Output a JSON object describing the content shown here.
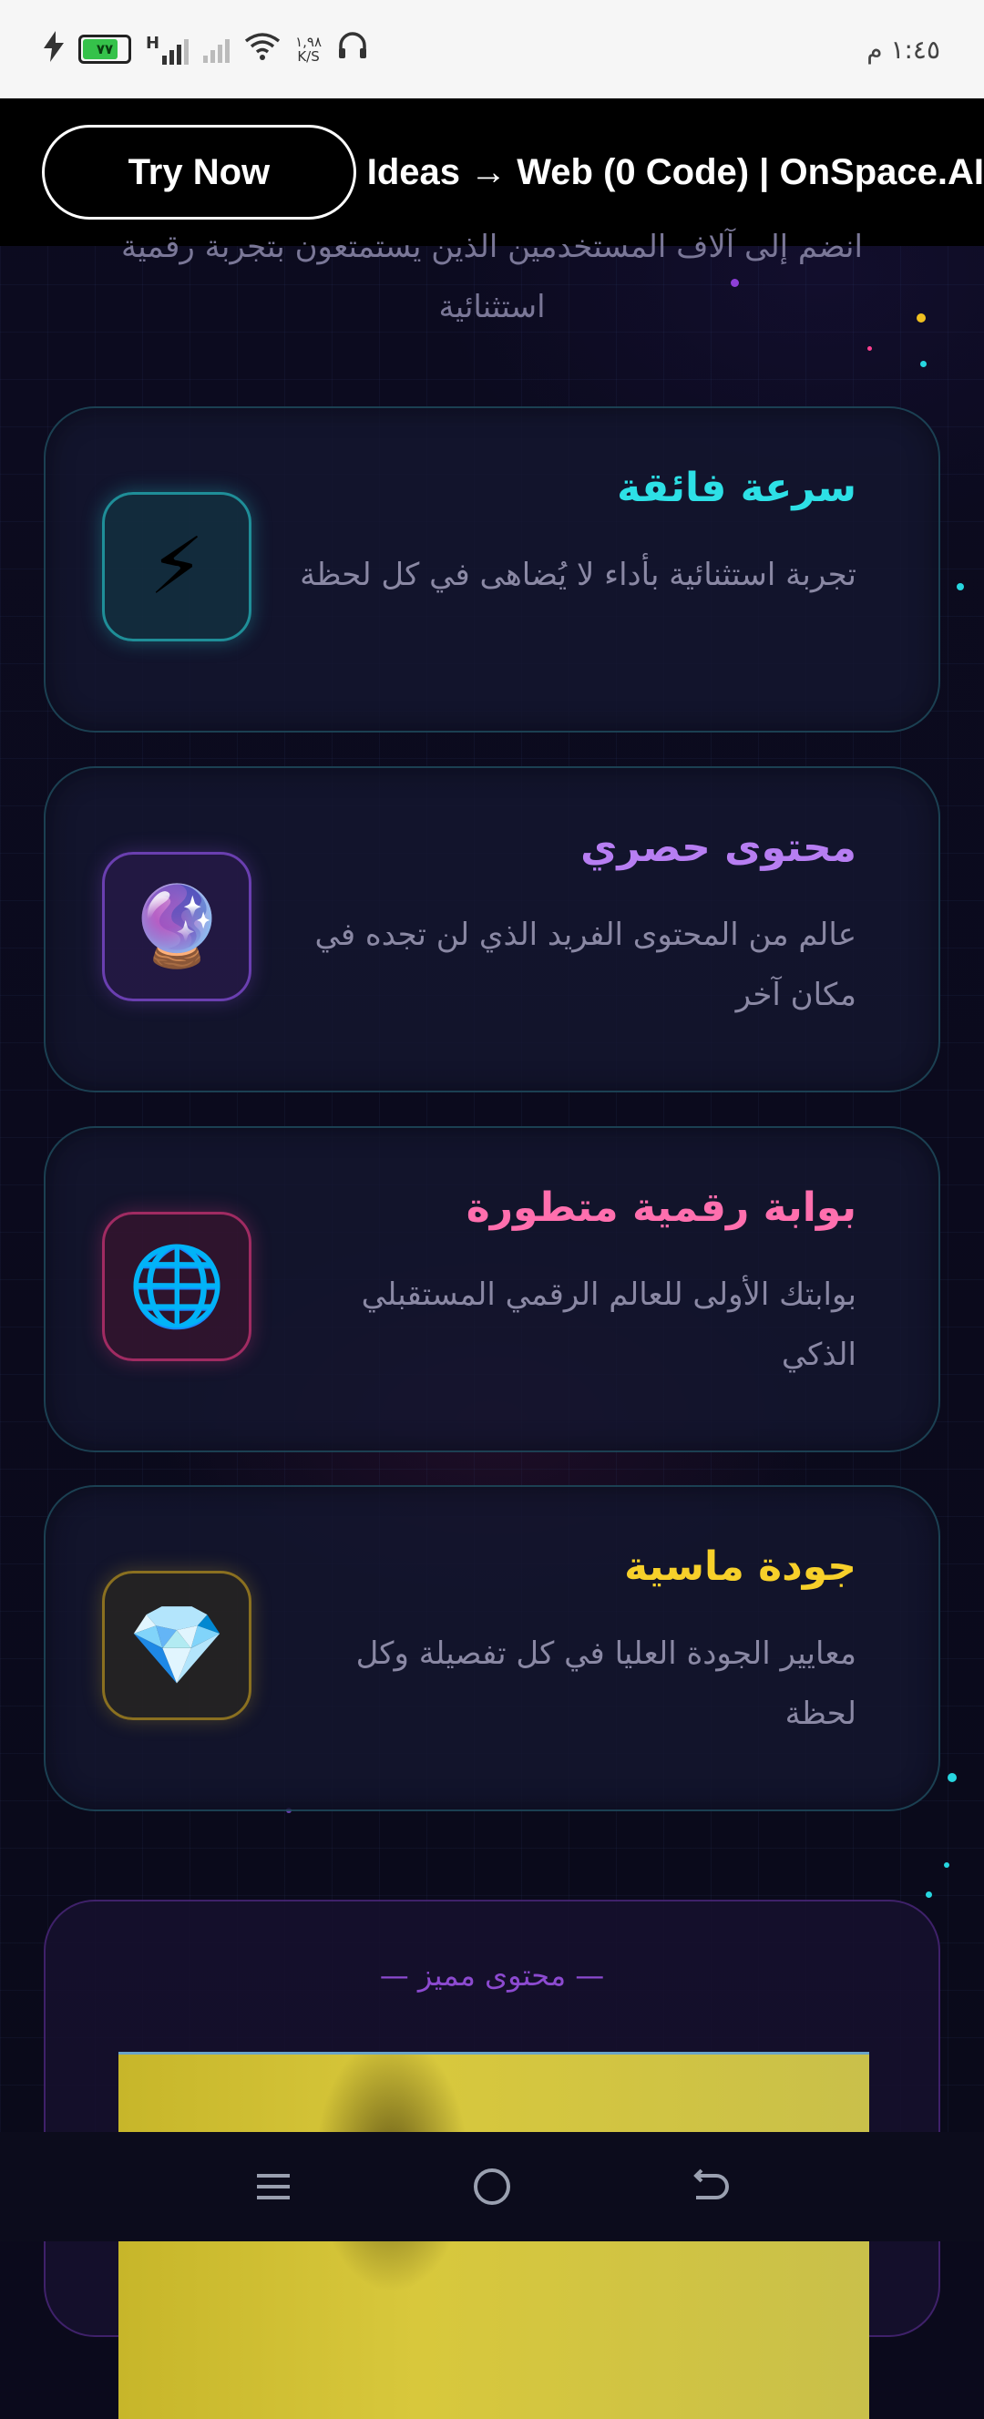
{
  "status_bar": {
    "time": "١:٤٥ م",
    "battery": "٧٧",
    "network_type": "H",
    "speed_value": "١,٩٨",
    "speed_unit": "K/S"
  },
  "banner": {
    "cta_label": "Try Now",
    "title": "Ideas → Web (0 Code) | OnSpace.AI"
  },
  "intro": {
    "text": "انضم إلى آلاف المستخدمين الذين يستمتعون بتجربة رقمية استثنائية"
  },
  "features": [
    {
      "title": "سرعة فائقة",
      "description": "تجربة استثنائية بأداء لا يُضاهى في كل لحظة",
      "icon": "lightning-icon",
      "glyph": "⚡",
      "title_color": "#2de0e6",
      "border_color": "#1f8e98"
    },
    {
      "title": "محتوى حصري",
      "description": "عالم من المحتوى الفريد الذي لن تجده في مكان آخر",
      "icon": "crystal-ball-icon",
      "glyph": "🔮",
      "title_color": "#b77ef2",
      "border_color": "#6a3fb0"
    },
    {
      "title": "بوابة رقمية متطورة",
      "description": "بوابتك الأولى للعالم الرقمي المستقبلي الذكي",
      "icon": "globe-icon",
      "glyph": "🌐",
      "title_color": "#ff6fae",
      "border_color": "#a02b62"
    },
    {
      "title": "جودة ماسية",
      "description": "معايير الجودة العليا في كل تفصيلة وكل لحظة",
      "icon": "diamond-icon",
      "glyph": "💎",
      "title_color": "#f7d02a",
      "border_color": "#8a7020"
    }
  ],
  "premium": {
    "label": "— محتوى مميز —"
  }
}
